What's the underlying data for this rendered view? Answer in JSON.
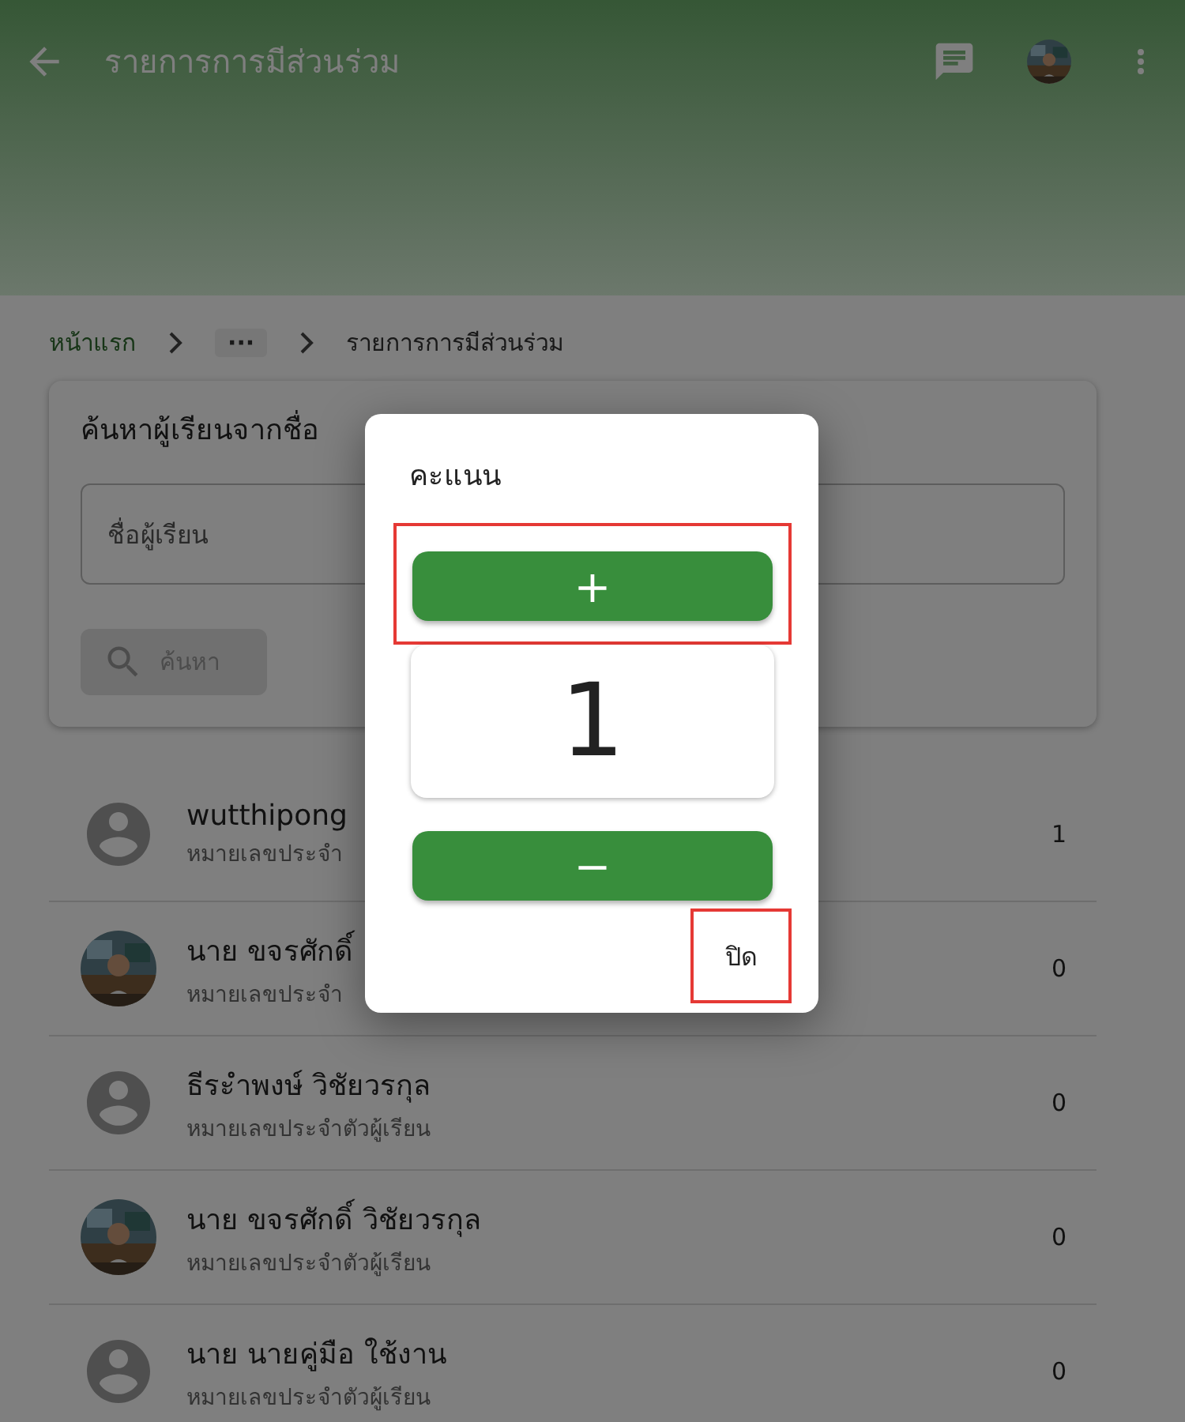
{
  "app_bar": {
    "title": "รายการการมีส่วนร่วม"
  },
  "breadcrumb": [
    {
      "label": "หน้าแรก",
      "kind": "link"
    },
    {
      "label": "···",
      "kind": "chip"
    },
    {
      "label": "รายการการมีส่วนร่วม",
      "kind": "current"
    }
  ],
  "search": {
    "title": "ค้นหาผู้เรียนจากชื่อ",
    "placeholder": "ชื่อผู้เรียน",
    "button": "ค้นหา",
    "button_disabled": true
  },
  "students": [
    {
      "name": "wutthipong",
      "subtitle": "หมายเลขประจำ",
      "score": "1",
      "kind": "default"
    },
    {
      "name": "นาย ขจรศักดิ์",
      "subtitle": "หมายเลขประจำ",
      "score": "0"
    },
    {
      "name": "ธีระำพงษ์ วิชัยวรกุล",
      "subtitle": "หมายเลขประจำตัวผู้เรียน",
      "score": "0",
      "kind": "default"
    },
    {
      "name": "นาย ขจรศักดิ์ วิชัยวรกุล",
      "subtitle": "หมายเลขประจำตัวผู้เรียน",
      "score": "0"
    },
    {
      "name": "นาย นายคู่มือ ใช้งาน",
      "subtitle": "หมายเลขประจำตัวผู้เรียน",
      "score": "0",
      "kind": "default"
    }
  ],
  "dialog": {
    "title": "คะแนน",
    "increment": {
      "label": "+",
      "highlighted": true
    },
    "value": "1",
    "decrement": {
      "label": "−",
      "highlighted": false
    },
    "close": {
      "label": "ปิด",
      "highlighted": true
    }
  }
}
